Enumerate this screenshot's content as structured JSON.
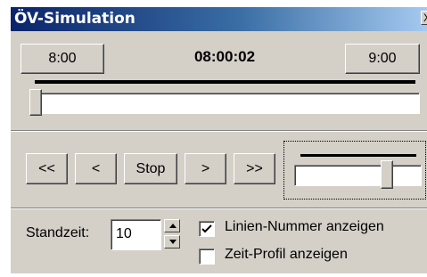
{
  "window": {
    "title": "ÖV-Simulation",
    "close_glyph": "X"
  },
  "time": {
    "start_label": "8:00",
    "current": "08:00:02",
    "end_label": "9:00",
    "position_fraction": 0.0
  },
  "playback": {
    "rewind_fast_label": "<<",
    "step_back_label": "<",
    "stop_label": "Stop",
    "step_forward_label": ">",
    "forward_fast_label": ">>",
    "speed_fraction": 0.75
  },
  "options": {
    "standzeit_label": "Standzeit:",
    "standzeit_value": "10",
    "linien_nummer_label": "Linien-Nummer anzeigen",
    "linien_nummer_checked": true,
    "zeit_profil_label": "Zeit-Profil anzeigen",
    "zeit_profil_checked": false
  },
  "icons": {
    "close": "close-icon",
    "checkmark": "checkmark-icon",
    "spin_up": "spin-up-icon",
    "spin_down": "spin-down-icon"
  },
  "colors": {
    "title_gradient_start": "#0a246a",
    "title_gradient_end": "#a6caf0",
    "face": "#d4d0c8"
  }
}
